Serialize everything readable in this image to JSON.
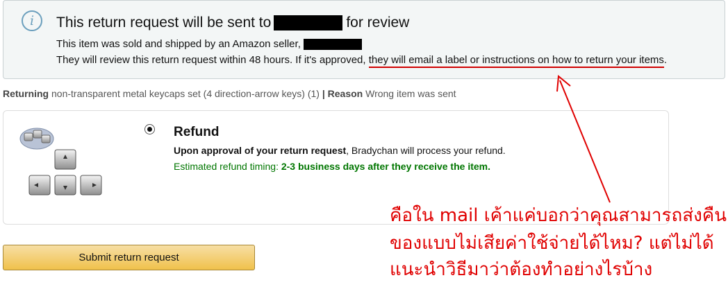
{
  "alert": {
    "icon": "info-icon",
    "icon_glyph": "i",
    "title_before": "This return request will be sent to",
    "title_after": "for review",
    "line1": "This item was sold and shipped by an Amazon seller,",
    "line2_before": "They will review this return request within 48 hours. If it's approved,",
    "line2_underlined": "they will email a label or instructions on how to return your items",
    "line2_after": "."
  },
  "summary": {
    "returning_label": "Returning",
    "item": "non-transparent metal keycaps set (4 direction-arrow keys) (1)",
    "separator": "|",
    "reason_label": "Reason",
    "reason": "Wrong item was sent"
  },
  "refund": {
    "title": "Refund",
    "approval_bold": "Upon approval of your return request",
    "approval_rest": ", Bradychan will process your refund.",
    "timing_label": "Estimated refund timing:",
    "timing_value": "2-3 business days after they receive the item.",
    "image_icon": "keycaps-product-image"
  },
  "submit_label": "Submit return request",
  "annotation": {
    "color": "#e00000",
    "lines": [
      "คือใน mail เค้าแค่บอกว่าคุณสามารถส่งคืน",
      "ของแบบไม่เสียค่าใช้จ่ายได้ไหม? แต่ไม่ได้",
      "แนะนำวิธีมาว่าต้องทำอย่างไรบ้าง"
    ]
  },
  "colors": {
    "alert_bg": "#f3f6f6",
    "info_blue": "#6b9fbd",
    "green": "#007600",
    "button": "#f0c14b"
  }
}
